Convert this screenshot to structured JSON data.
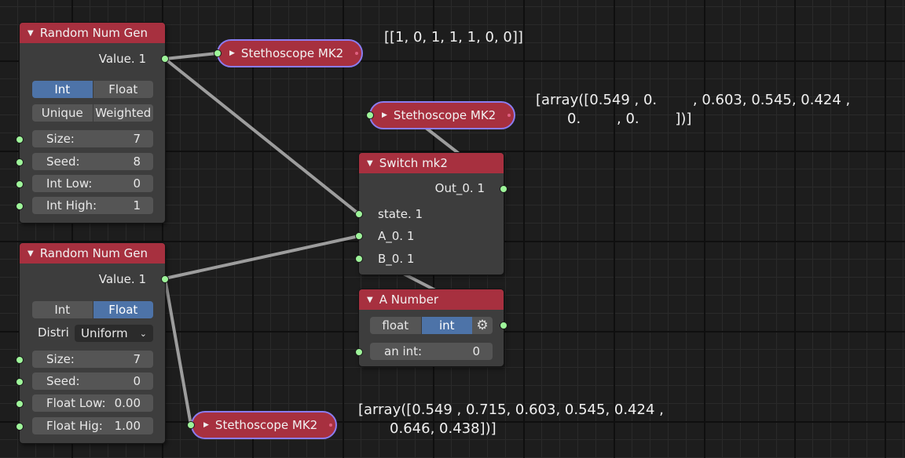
{
  "nodes": {
    "rng1": {
      "title": "Random Num Gen",
      "output": "Value. 1",
      "mode_int": "Int",
      "mode_float": "Float",
      "unique": "Unique",
      "weighted": "Weighted",
      "size": {
        "label": "Size:",
        "value": "7"
      },
      "seed": {
        "label": "Seed:",
        "value": "8"
      },
      "low": {
        "label": "Int Low:",
        "value": "0"
      },
      "high": {
        "label": "Int High:",
        "value": "1"
      }
    },
    "rng2": {
      "title": "Random Num Gen",
      "output": "Value. 1",
      "mode_int": "Int",
      "mode_float": "Float",
      "distri_label": "Distri",
      "distri_value": "Uniform",
      "size": {
        "label": "Size:",
        "value": "7"
      },
      "seed": {
        "label": "Seed:",
        "value": "0"
      },
      "low": {
        "label": "Float Low:",
        "value": "0.00"
      },
      "high": {
        "label": "Float Hig:",
        "value": "1.00"
      }
    },
    "switch": {
      "title": "Switch mk2",
      "output": "Out_0. 1",
      "state": "state. 1",
      "a": "A_0. 1",
      "b": "B_0. 1"
    },
    "number": {
      "title": "A Number",
      "mode_float": "float",
      "mode_int": "int",
      "an_int": {
        "label": "an int:",
        "value": "0"
      }
    },
    "steth1": {
      "title": "Stethoscope MK2"
    },
    "steth2": {
      "title": "Stethoscope MK2"
    },
    "steth3": {
      "title": "Stethoscope MK2"
    }
  },
  "outputs": {
    "steth1": "[[1, 0, 1, 1, 1, 0, 0]]",
    "steth2_line1": "[array([0.549 , 0.        , 0.603, 0.545, 0.424 ,",
    "steth2_line2": "       0.        , 0.        ])]",
    "steth3_line1": "[array([0.549 , 0.715, 0.603, 0.545, 0.424 ,",
    "steth3_line2": "       0.646, 0.438])]"
  },
  "colors": {
    "header": "#a7303f",
    "socket": "#9ef59a",
    "active_toggle": "#4d73a8",
    "steth_border": "#8b7cf0"
  }
}
